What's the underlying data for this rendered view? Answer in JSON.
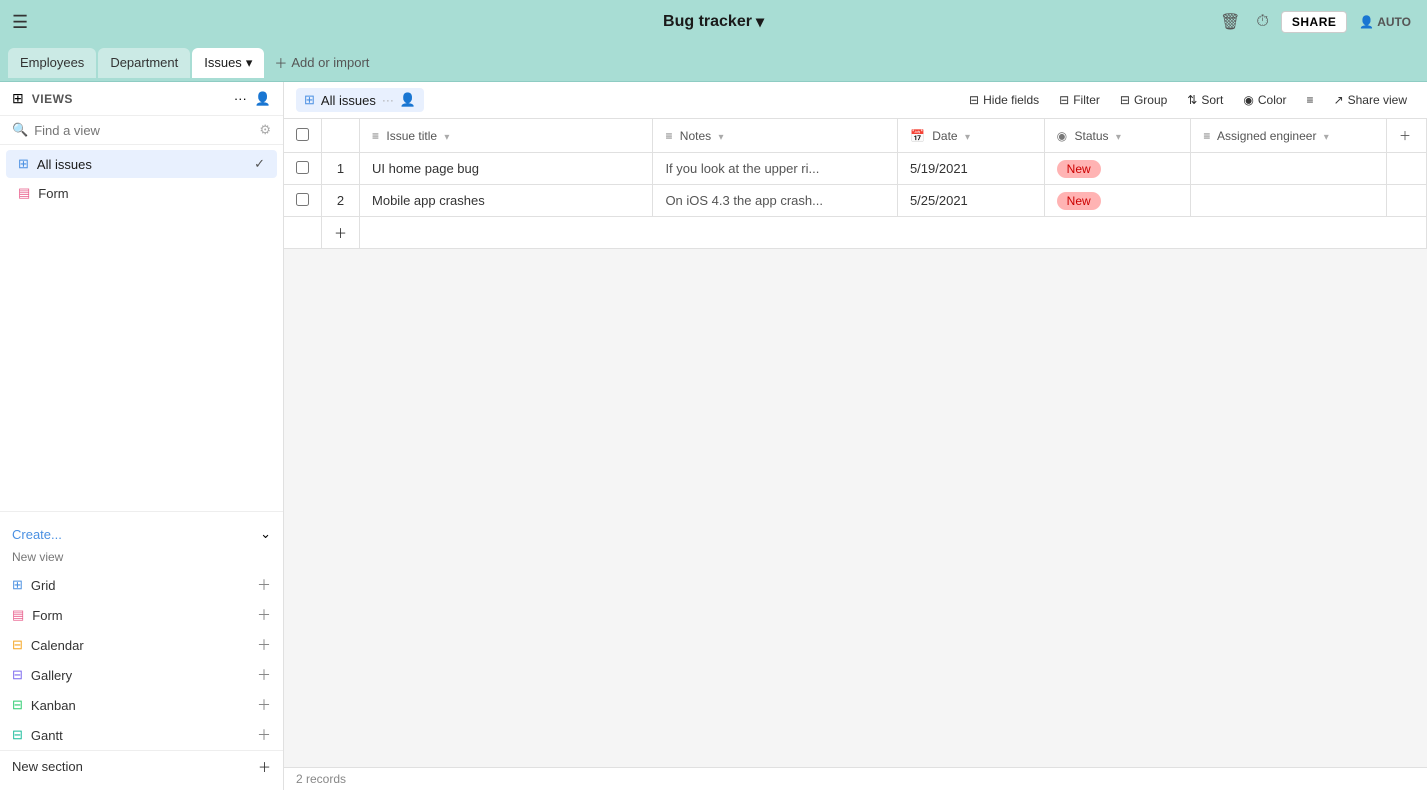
{
  "app": {
    "title": "Bug tracker",
    "title_arrow": "▾"
  },
  "top_bar": {
    "hamburger": "☰",
    "trash_icon": "🗑",
    "history_icon": "⏱",
    "share_label": "SHARE",
    "auto_label": "AUTO"
  },
  "nav_tabs": {
    "employees_label": "Employees",
    "department_label": "Department",
    "issues_label": "Issues",
    "issues_arrow": "▾",
    "add_or_import_label": "Add or import"
  },
  "toolbar": {
    "views_label": "VIEWS",
    "all_issues_label": "All issues",
    "hide_fields_label": "Hide fields",
    "filter_label": "Filter",
    "group_label": "Group",
    "sort_label": "Sort",
    "color_label": "Color",
    "rows_icon": "≡",
    "share_view_label": "Share view"
  },
  "sidebar": {
    "search_placeholder": "Find a view",
    "gear_icon": "⚙",
    "people_icon": "👤",
    "views": [
      {
        "label": "All issues",
        "type": "grid",
        "active": true
      },
      {
        "label": "Form",
        "type": "form",
        "active": false
      }
    ],
    "create_label": "Create...",
    "create_arrow": "⌄",
    "new_view_label": "New view",
    "create_items": [
      {
        "label": "Grid",
        "type": "grid"
      },
      {
        "label": "Form",
        "type": "form"
      },
      {
        "label": "Calendar",
        "type": "calendar"
      },
      {
        "label": "Gallery",
        "type": "gallery"
      },
      {
        "label": "Kanban",
        "type": "kanban"
      },
      {
        "label": "Gantt",
        "type": "gantt"
      }
    ],
    "new_section_label": "New section"
  },
  "table": {
    "columns": [
      {
        "label": "Issue title",
        "icon": "≡"
      },
      {
        "label": "Notes",
        "icon": "≡"
      },
      {
        "label": "Date",
        "icon": "📅"
      },
      {
        "label": "Status",
        "icon": "◉"
      },
      {
        "label": "Assigned engineer",
        "icon": "≡"
      }
    ],
    "rows": [
      {
        "num": "1",
        "issue_title": "UI home page bug",
        "notes": "If you look at the upper ri...",
        "date": "5/19/2021",
        "status": "New",
        "engineer": ""
      },
      {
        "num": "2",
        "issue_title": "Mobile app crashes",
        "notes": "On iOS 4.3 the app crash...",
        "date": "5/25/2021",
        "status": "New",
        "engineer": ""
      }
    ],
    "records_label": "2 records"
  }
}
